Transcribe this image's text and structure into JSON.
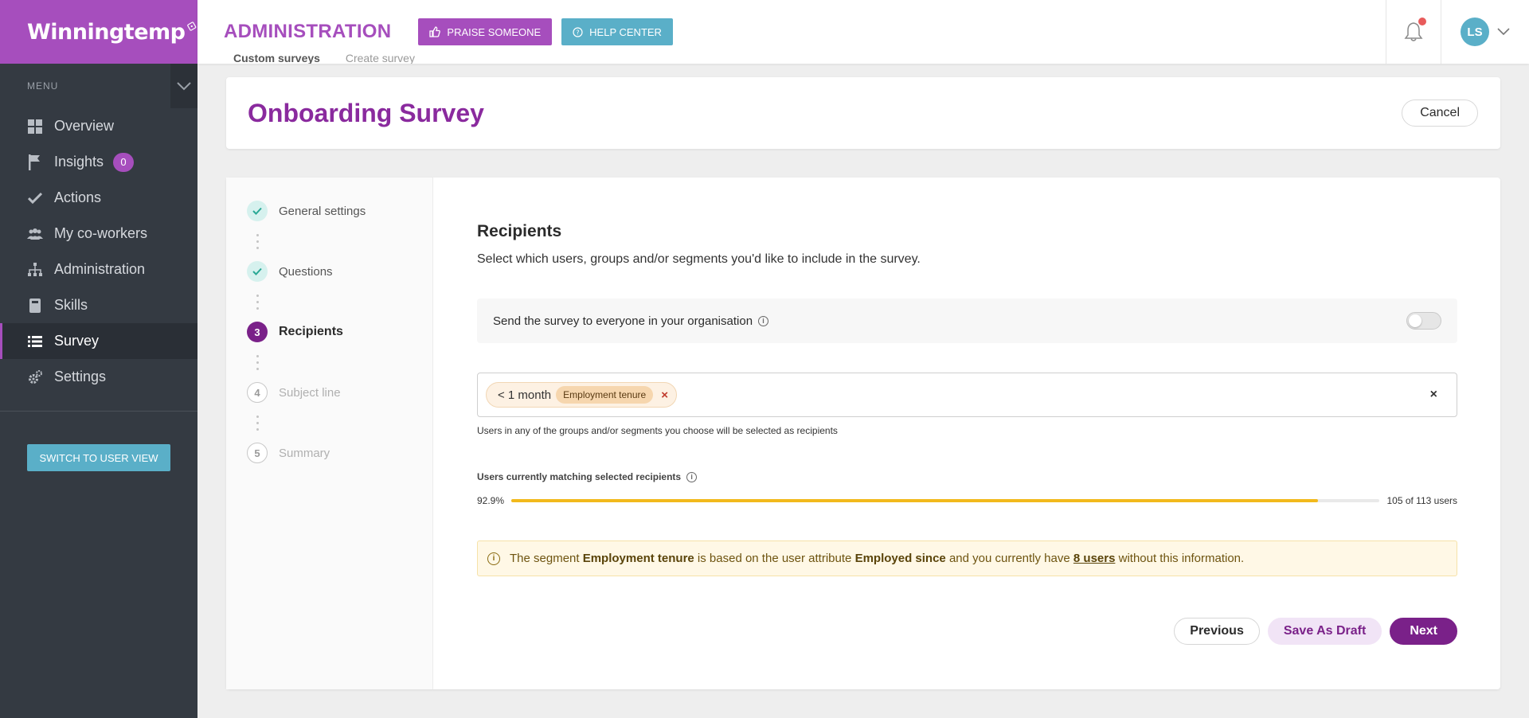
{
  "brand": {
    "name": "Winningtemp"
  },
  "sidebar": {
    "menu_label": "MENU",
    "items": [
      {
        "label": "Overview",
        "icon": "grid-icon"
      },
      {
        "label": "Insights",
        "icon": "flag-icon",
        "badge": "0"
      },
      {
        "label": "Actions",
        "icon": "check-icon"
      },
      {
        "label": "My co-workers",
        "icon": "people-icon"
      },
      {
        "label": "Administration",
        "icon": "hierarchy-icon"
      },
      {
        "label": "Skills",
        "icon": "book-icon"
      },
      {
        "label": "Survey",
        "icon": "list-icon",
        "active": true
      },
      {
        "label": "Settings",
        "icon": "gears-icon"
      }
    ],
    "switch_label": "SWITCH TO USER VIEW"
  },
  "topbar": {
    "title": "ADMINISTRATION",
    "praise_label": "PRAISE SOMEONE",
    "help_label": "HELP CENTER",
    "avatar_initials": "LS"
  },
  "breadcrumb": {
    "parent": "Custom surveys",
    "current": "Create survey"
  },
  "page": {
    "title": "Onboarding Survey",
    "cancel_label": "Cancel"
  },
  "steps": [
    {
      "number": "",
      "label": "General settings",
      "state": "done"
    },
    {
      "number": "",
      "label": "Questions",
      "state": "done"
    },
    {
      "number": "3",
      "label": "Recipients",
      "state": "current"
    },
    {
      "number": "4",
      "label": "Subject line",
      "state": "todo"
    },
    {
      "number": "5",
      "label": "Summary",
      "state": "todo"
    }
  ],
  "recipients": {
    "title": "Recipients",
    "description": "Select which users, groups and/or segments you'd like to include in the survey.",
    "everyone_label": "Send the survey to everyone in your organisation",
    "everyone_enabled": false,
    "chip_value": "< 1 month",
    "chip_tag": "Employment tenure",
    "chip_remove": "×",
    "clear_all": "×",
    "hint": "Users in any of the groups and/or segments you choose will be selected as recipients",
    "matching_label": "Users currently matching selected recipients",
    "percent_label": "92.9%",
    "percent_value": 92.9,
    "count_label": "105 of 113 users",
    "notice": {
      "prefix": "The segment",
      "segment": "Employment tenure",
      "middle": "is based on the user attribute",
      "attribute": "Employed since",
      "middle2": "and you currently have",
      "users": "8 users",
      "suffix": "without this information."
    }
  },
  "buttons": {
    "previous": "Previous",
    "draft": "Save As Draft",
    "next": "Next"
  },
  "colors": {
    "brand": "#a64ebd",
    "accent_dark": "#7a2189",
    "help": "#5aafc8",
    "progress": "#f2b91c"
  }
}
